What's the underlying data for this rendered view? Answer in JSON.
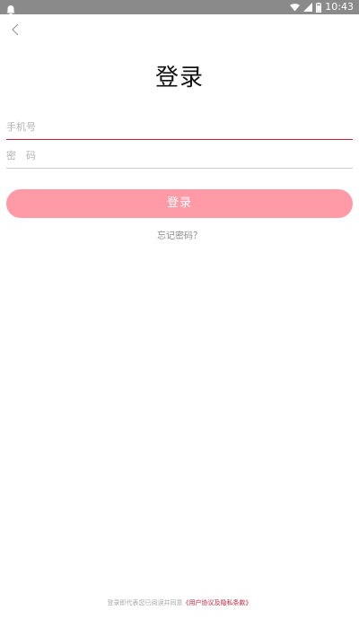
{
  "status_bar": {
    "time": "10:43",
    "left_icon": "notification-icon",
    "right_icons": [
      "wifi-icon",
      "signal-icon",
      "battery-icon"
    ],
    "background": "#8a8a8a"
  },
  "header": {
    "back_icon": "chevron-left-icon"
  },
  "page": {
    "title": "登录"
  },
  "form": {
    "phone_placeholder": "手机号",
    "password_placeholder": "密　码",
    "login_label": "登录",
    "forgot_label": "忘记密码？"
  },
  "footer": {
    "prefix": "登录即代表您已阅读并同意",
    "terms_link": "《用户协议及隐私条款》"
  },
  "colors": {
    "accent": "#c41e3a",
    "button": "#ff9aa6"
  }
}
